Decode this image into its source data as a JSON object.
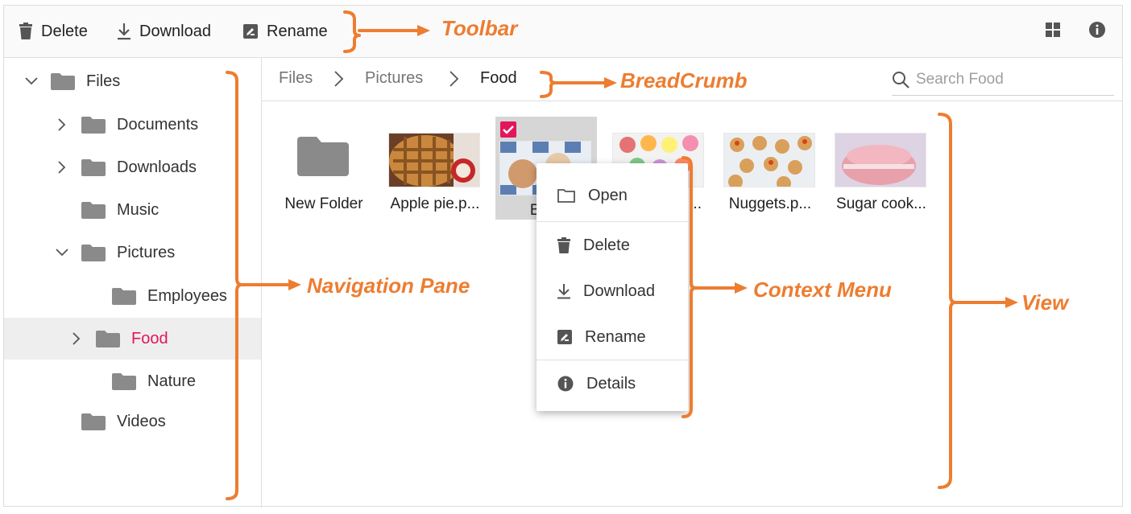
{
  "toolbar": {
    "delete_label": "Delete",
    "download_label": "Download",
    "rename_label": "Rename"
  },
  "navigation": {
    "items": [
      {
        "label": "Files",
        "expanded": true
      },
      {
        "label": "Documents",
        "expanded": false
      },
      {
        "label": "Downloads",
        "expanded": false
      },
      {
        "label": "Music"
      },
      {
        "label": "Pictures",
        "expanded": true
      },
      {
        "label": "Employees"
      },
      {
        "label": "Food",
        "selected": true,
        "expanded": false
      },
      {
        "label": "Nature"
      },
      {
        "label": "Videos"
      }
    ]
  },
  "breadcrumb": {
    "items": [
      "Files",
      "Pictures",
      "Food"
    ]
  },
  "search": {
    "placeholder": "Search Food"
  },
  "files": [
    {
      "name": "New Folder",
      "type": "folder"
    },
    {
      "name": "Apple pie.p...",
      "type": "image"
    },
    {
      "name": "Brea",
      "type": "image",
      "selected": true
    },
    {
      "name": "...",
      "type": "image"
    },
    {
      "name": "Nuggets.p...",
      "type": "image"
    },
    {
      "name": "Sugar cook...",
      "type": "image"
    }
  ],
  "context_menu": {
    "items": [
      "Open",
      "Delete",
      "Download",
      "Rename",
      "Details"
    ]
  },
  "annotations": {
    "toolbar": "Toolbar",
    "breadcrumb": "BreadCrumb",
    "navigation_pane": "Navigation Pane",
    "context_menu": "Context Menu",
    "view": "View"
  },
  "colors": {
    "accent": "#e3165b",
    "annotation": "#ed7d31",
    "folder": "#8a8a8a"
  }
}
